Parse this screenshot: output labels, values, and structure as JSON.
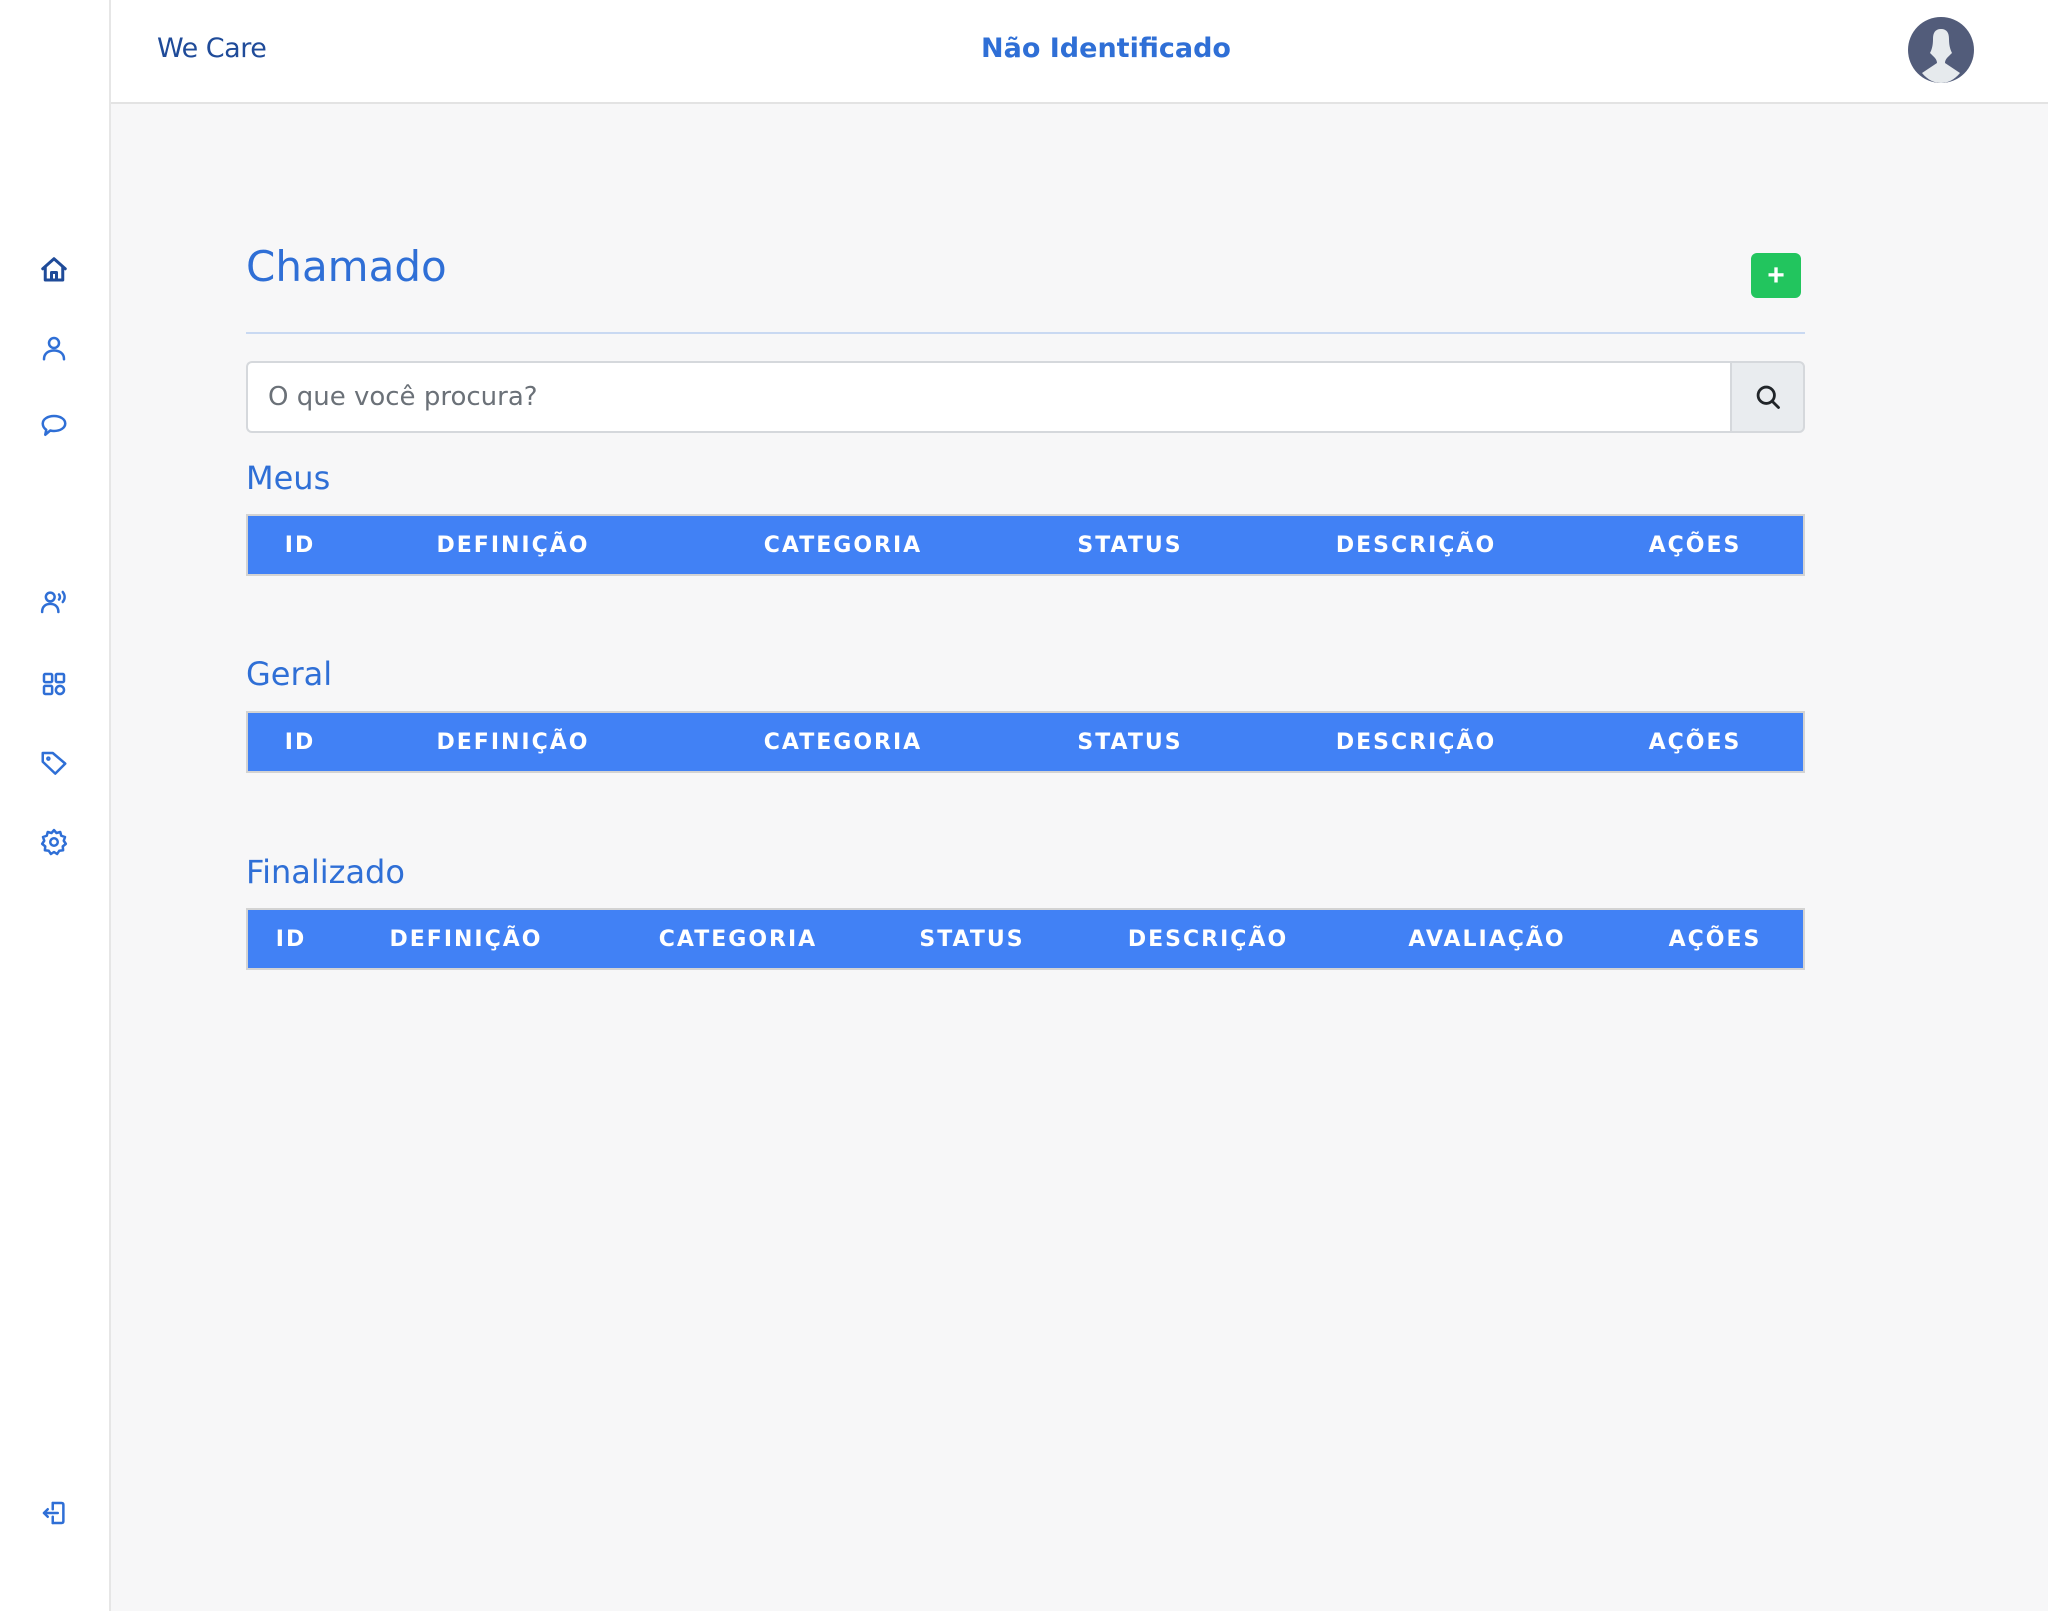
{
  "header": {
    "brand": "We Care",
    "user_status": "Não Identificado",
    "avatar_icon": "user-avatar-icon"
  },
  "sidebar": {
    "items": [
      {
        "name": "home",
        "icon": "home-icon",
        "active": true
      },
      {
        "name": "profile",
        "icon": "user-icon",
        "active": false
      },
      {
        "name": "chat",
        "icon": "chat-bubble-icon",
        "active": false
      },
      {
        "name": "contacts",
        "icon": "user-voice-icon",
        "active": false
      },
      {
        "name": "dashboard",
        "icon": "grid-icon",
        "active": false
      },
      {
        "name": "tags",
        "icon": "tag-icon",
        "active": false
      },
      {
        "name": "settings",
        "icon": "gear-icon",
        "active": false
      }
    ],
    "logout_icon": "logout-icon"
  },
  "colors": {
    "primary": "#2f6fd6",
    "brand": "#1f4b99",
    "table_header": "#4181f5",
    "add_button": "#22c55e",
    "background": "#f7f7f8"
  },
  "main": {
    "title": "Chamado",
    "add_label": "+",
    "search": {
      "placeholder": "O que você procura?",
      "value": ""
    },
    "sections": [
      {
        "title": "Meus",
        "columns": [
          "ID",
          "DEFINIÇÃO",
          "CATEGORIA",
          "STATUS",
          "DESCRIÇÃO",
          "AÇÕES"
        ],
        "rows": []
      },
      {
        "title": "Geral",
        "columns": [
          "ID",
          "DEFINIÇÃO",
          "CATEGORIA",
          "STATUS",
          "DESCRIÇÃO",
          "AÇÕES"
        ],
        "rows": []
      },
      {
        "title": "Finalizado",
        "columns": [
          "ID",
          "DEFINIÇÃO",
          "CATEGORIA",
          "STATUS",
          "DESCRIÇÃO",
          "AVALIAÇÃO",
          "AÇÕES"
        ],
        "rows": []
      }
    ]
  }
}
